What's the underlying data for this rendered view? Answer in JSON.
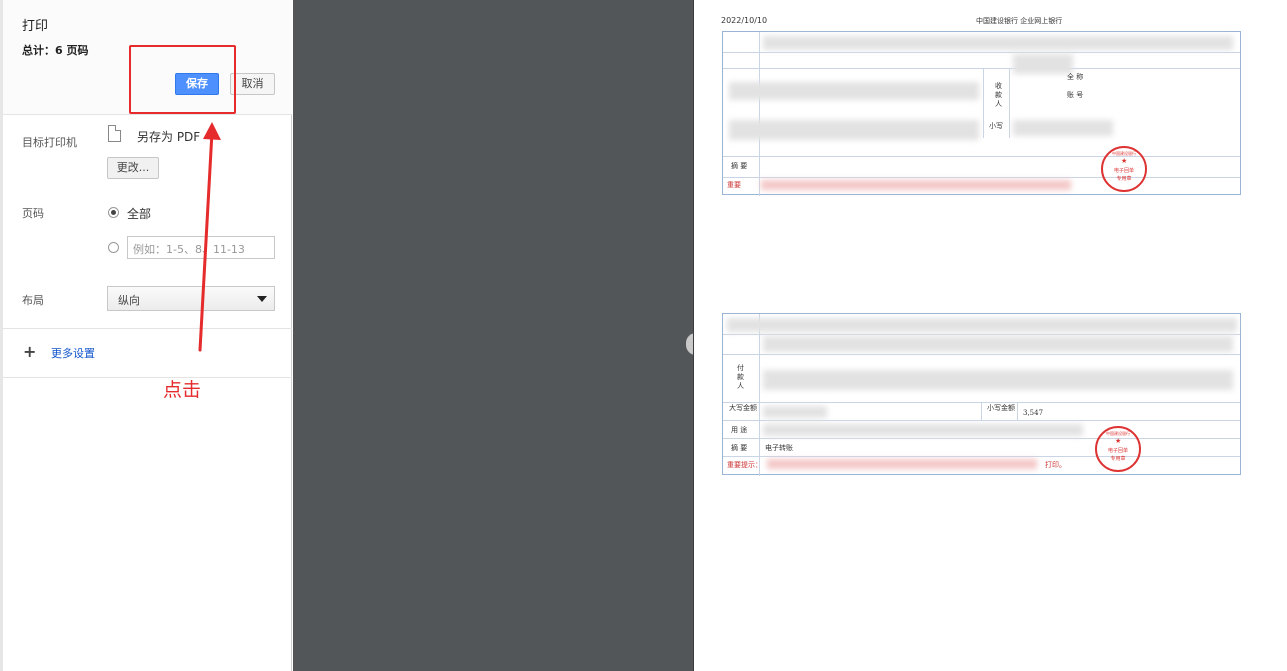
{
  "panel": {
    "title": "打印",
    "total": "总计：6 页码",
    "save_label": "保存",
    "cancel_label": "取消"
  },
  "destination": {
    "label": "目标打印机",
    "printer_name": "另存为 PDF",
    "change_label": "更改..."
  },
  "pages": {
    "label": "页码",
    "all_label": "全部",
    "custom_placeholder": "例如：1-5、8、11-13"
  },
  "layout": {
    "label": "布局",
    "selected": "纵向"
  },
  "more_settings": {
    "label": "更多设置"
  },
  "annotation": {
    "label": "点击",
    "color": "#e52b2b"
  },
  "preview": {
    "date": "2022/10/10",
    "bank_title": "中国建设银行 企业网上银行",
    "receipt1": {
      "payee_label": "收款人",
      "name_label": "全 称",
      "account_label": "账 号",
      "small_label": "小写",
      "summary_label": "摘 要",
      "notice_label": "重要"
    },
    "receipt2": {
      "payer_label": "付款人",
      "amount_upper_label": "大写金额",
      "amount_lower_label": "小写金额",
      "amount_value": "3,547",
      "purpose_label": "用 途",
      "summary_label": "摘 要",
      "summary_value": "电子转账",
      "notice_label": "重要提示：",
      "notice_tail": "打印。"
    },
    "stamp": {
      "line1": "电子回单",
      "line2": "专用章",
      "ring": "中国建设银行"
    }
  }
}
